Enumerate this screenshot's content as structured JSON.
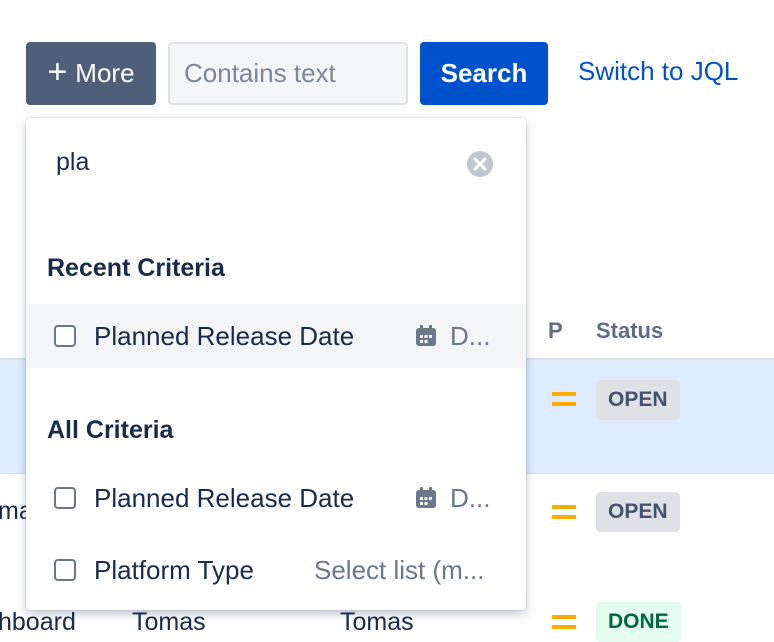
{
  "toolbar": {
    "more_label": "More",
    "text_placeholder": "Contains text",
    "search_label": "Search",
    "switch_jql_label": "Switch to JQL"
  },
  "table": {
    "columns": {
      "priority": "P",
      "status": "Status"
    },
    "rows": [
      {
        "summary": "",
        "assignee": "",
        "reporter": "",
        "status": "OPEN"
      },
      {
        "summary": "ma",
        "assignee": "",
        "reporter": "",
        "status": "OPEN"
      },
      {
        "summary": "hboard",
        "assignee": "Tomas",
        "reporter": "Tomas",
        "status": "DONE"
      }
    ]
  },
  "dropdown": {
    "search_value": "pla",
    "recent": {
      "title": "Recent Criteria",
      "items": [
        {
          "label": "Planned Release Date",
          "type": "D...",
          "icon": "calendar-icon"
        }
      ]
    },
    "all": {
      "title": "All Criteria",
      "items": [
        {
          "label": "Planned Release Date",
          "type": "D...",
          "icon": "calendar-icon"
        },
        {
          "label": "Platform Type",
          "type": "Select list (m...",
          "icon": ""
        }
      ]
    }
  },
  "colors": {
    "primary": "#0052cc",
    "neutral_button": "#505f79",
    "priority_medium": "#ffab00",
    "row_highlight": "#deebff",
    "done_green": "#006644"
  }
}
